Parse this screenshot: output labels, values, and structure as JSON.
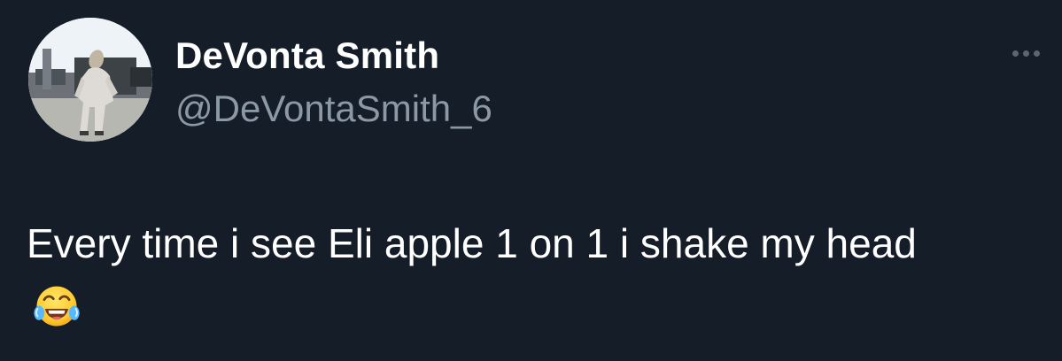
{
  "author": {
    "display_name": "DeVonta Smith",
    "handle": "@DeVontaSmith_6"
  },
  "tweet": {
    "text": "Every time i see Eli apple 1 on 1 i shake my head",
    "emoji": "face-with-tears-of-joy"
  },
  "icons": {
    "more": "more-options-icon",
    "avatar": "profile-photo"
  },
  "colors": {
    "background": "#151d28",
    "primary_text": "#ffffff",
    "secondary_text": "#8b98a5",
    "muted_icon": "#596673"
  }
}
